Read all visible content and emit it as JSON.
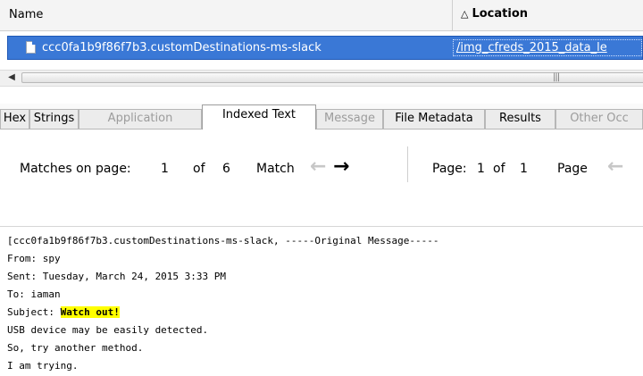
{
  "table": {
    "col_name": "Name",
    "col_location": "Location",
    "row": {
      "name": "ccc0fa1b9f86f7b3.customDestinations-ms-slack",
      "location": "/img_cfreds_2015_data_le"
    }
  },
  "tabs": [
    {
      "label": "Hex",
      "state": "normal"
    },
    {
      "label": "Strings",
      "state": "normal"
    },
    {
      "label": "Application",
      "state": "disabled"
    },
    {
      "label": "Indexed Text",
      "state": "active"
    },
    {
      "label": "Message",
      "state": "disabled"
    },
    {
      "label": "File Metadata",
      "state": "normal"
    },
    {
      "label": "Results",
      "state": "normal"
    },
    {
      "label": "Other Occ",
      "state": "disabled"
    }
  ],
  "toolbar": {
    "matches_label": "Matches on page:",
    "match_current": "1",
    "of_label": "of",
    "match_total": "6",
    "match_label": "Match",
    "page_label": "Page:",
    "page_current": "1",
    "page_of": "of",
    "page_total": "1",
    "page_nav_label": "Page"
  },
  "content": {
    "line1": "[ccc0fa1b9f86f7b3.customDestinations-ms-slack, -----Original Message-----",
    "line2": "From: spy",
    "line3": "Sent: Tuesday, March 24, 2015 3:33 PM",
    "line4": "To: iaman",
    "line5_prefix": "Subject: ",
    "line5_highlight": "Watch out!",
    "line6": "USB device may be easily detected.",
    "line7": "So, try another method.",
    "line8": "I am trying."
  },
  "colors": {
    "selection": "#3a78d6",
    "highlight": "#ffff00"
  }
}
